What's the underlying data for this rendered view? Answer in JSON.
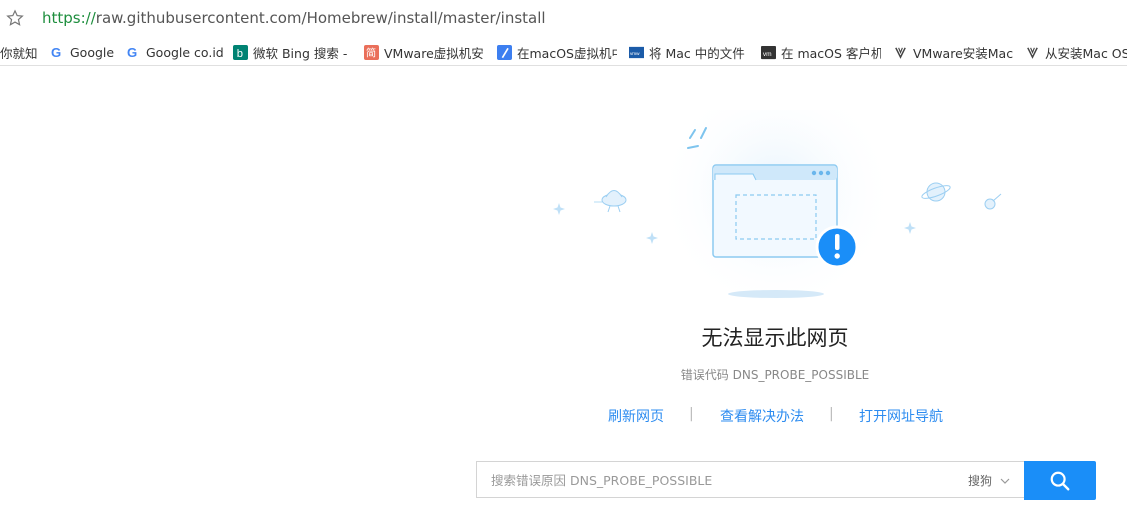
{
  "address_bar": {
    "url_scheme": "https://",
    "url_rest": "raw.githubusercontent.com/Homebrew/install/master/install"
  },
  "bookmarks": [
    {
      "label": "你就知",
      "icon": "zhihu-icon"
    },
    {
      "label": "Google",
      "icon": "google-icon"
    },
    {
      "label": "Google co.id",
      "icon": "google-icon"
    },
    {
      "label": "微软 Bing 搜索 -",
      "icon": "bing-icon"
    },
    {
      "label": "VMware虚拟机安",
      "icon": "jianshu-icon"
    },
    {
      "label": "在macOS虚拟机中",
      "icon": "pen-icon"
    },
    {
      "label": "将 Mac 中的文件",
      "icon": "vmware-icon"
    },
    {
      "label": "在 macOS 客户机",
      "icon": "vm-icon"
    },
    {
      "label": "VMware安装Mac",
      "icon": "csdn-icon"
    },
    {
      "label": "从安装Mac OS",
      "icon": "csdn-icon"
    }
  ],
  "error": {
    "title": "无法显示此网页",
    "code_label": "错误代码",
    "code": "DNS_PROBE_POSSIBLE"
  },
  "links": {
    "refresh": "刷新网页",
    "solutions": "查看解决办法",
    "navigation": "打开网址导航"
  },
  "search": {
    "placeholder": "搜索错误原因 DNS_PROBE_POSSIBLE",
    "engine": "搜狗"
  },
  "colors": {
    "accent": "#1a8ef8",
    "link": "#2d8cf0",
    "url_green": "#1e8e3e"
  }
}
